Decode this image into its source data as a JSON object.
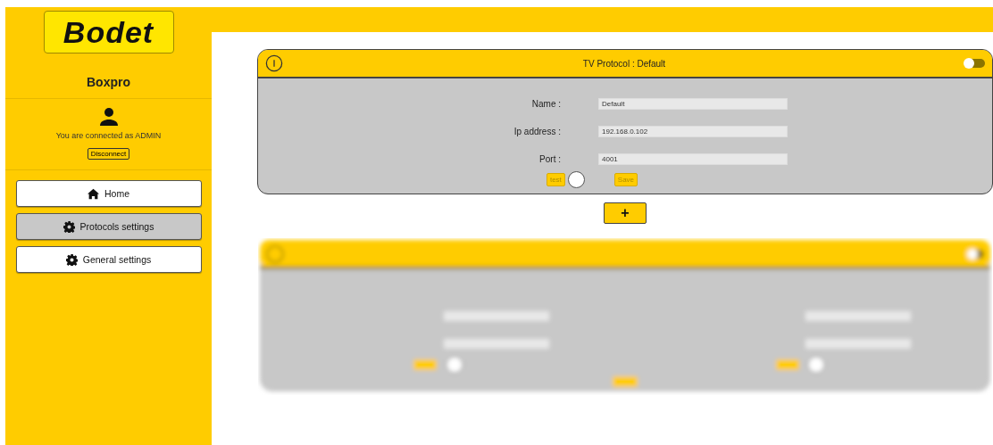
{
  "sidebar": {
    "logo": "Bodet",
    "device": "Boxpro",
    "user_text": "You are connected as ADMIN",
    "disconnect": "Disconnect",
    "items": [
      {
        "label": "Home",
        "kind": "home",
        "selected": false
      },
      {
        "label": "Protocols settings",
        "kind": "settings",
        "selected": true
      },
      {
        "label": "General settings",
        "kind": "settings",
        "selected": false
      }
    ]
  },
  "protocol_card": {
    "title": "TV Protocol : Default",
    "enabled": false,
    "fields": [
      {
        "label": "Name :",
        "value": "Default"
      },
      {
        "label": "Ip address :",
        "value": "192.168.0.102"
      },
      {
        "label": "Port :",
        "value": "4001"
      }
    ],
    "test_button": "test",
    "save_button": "Save"
  },
  "add_button": "+"
}
